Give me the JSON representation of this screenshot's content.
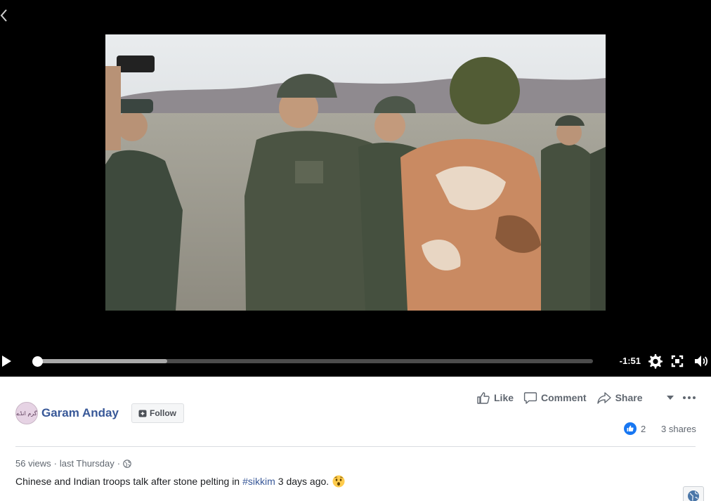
{
  "player": {
    "time_remaining": "-1:51",
    "progress_fraction": 0.0,
    "buffered_fraction": 0.233
  },
  "actions": {
    "like_label": "Like",
    "comment_label": "Comment",
    "share_label": "Share"
  },
  "page": {
    "name": "Garam Anday",
    "avatar_text": "گرم انڈے",
    "follow_label": "Follow"
  },
  "engagement": {
    "reaction_count": "2",
    "shares": "3 shares"
  },
  "meta": {
    "views": "56 views",
    "separator": "·",
    "date": "last Thursday"
  },
  "caption": {
    "before": "Chinese and Indian troops talk after stone pelting in",
    "hashtag": "#sikkim",
    "after": "3 days ago."
  },
  "colors": {
    "link_blue": "#385898",
    "like_blue": "#1877f2",
    "muted_text": "#606770"
  },
  "icons": [
    "chevron-left-icon",
    "play-icon",
    "settings-icon",
    "fullscreen-icon",
    "volume-icon",
    "thumbs-up-icon",
    "comment-icon",
    "share-icon",
    "caret-down-icon",
    "more-icon",
    "follow-icon",
    "like-reaction-icon",
    "globe-icon",
    "astonished-emoji-icon"
  ]
}
